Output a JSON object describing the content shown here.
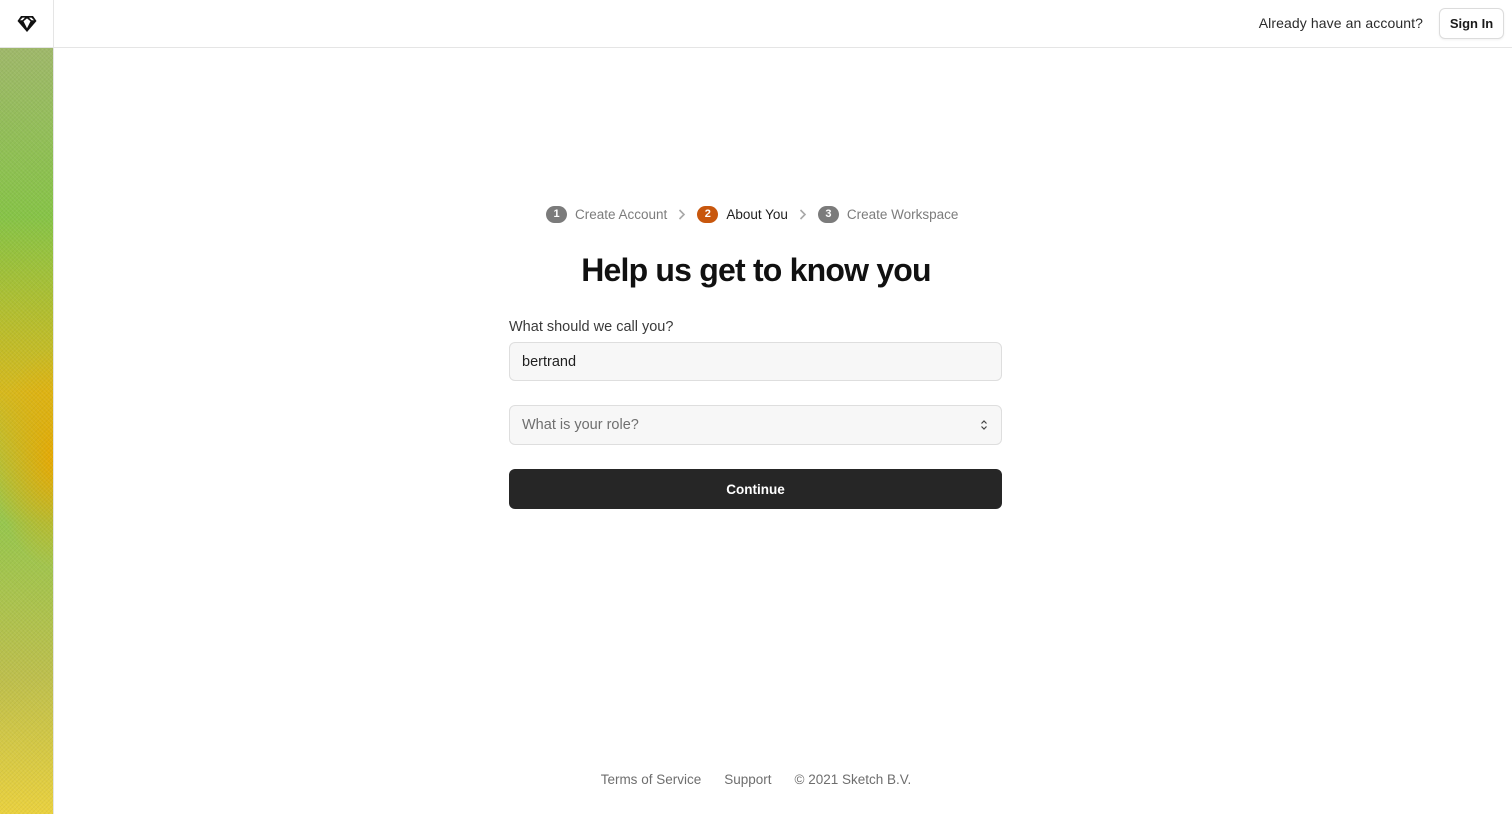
{
  "header": {
    "prompt": "Already have an account?",
    "sign_in_label": "Sign In",
    "logo_icon": "sketch-diamond-icon"
  },
  "stepper": {
    "steps": [
      {
        "number": "1",
        "label": "Create Account",
        "state": "done"
      },
      {
        "number": "2",
        "label": "About You",
        "state": "active"
      },
      {
        "number": "3",
        "label": "Create Workspace",
        "state": "pending"
      }
    ],
    "active_color": "#c8570d",
    "inactive_color": "#7b7b7b"
  },
  "form": {
    "title": "Help us get to know you",
    "name_label": "What should we call you?",
    "name_value": "bertrand",
    "role_placeholder": "What is your role?",
    "continue_label": "Continue"
  },
  "footer": {
    "terms": "Terms of Service",
    "support": "Support",
    "copyright": "© 2021 Sketch B.V."
  }
}
